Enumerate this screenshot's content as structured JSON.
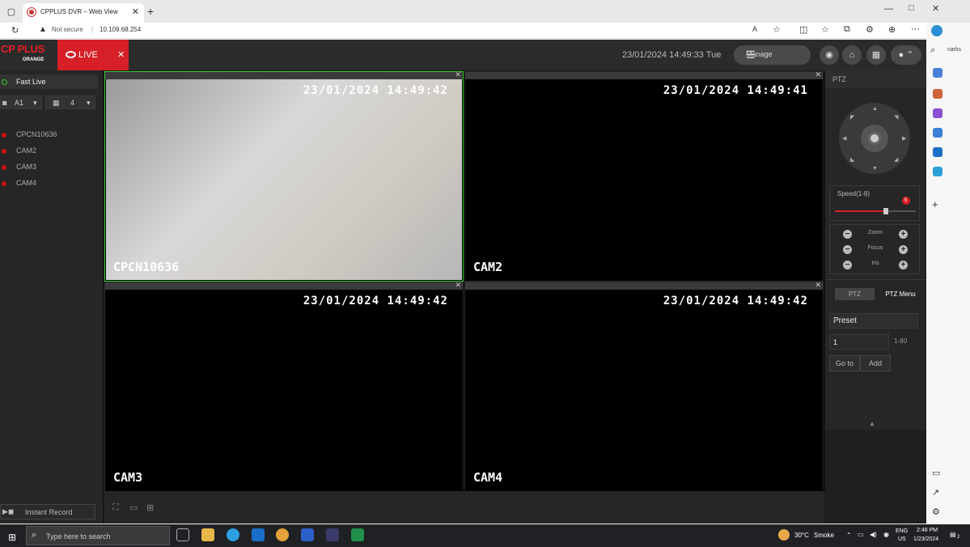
{
  "browser": {
    "tab_title": "CPPLUS DVR – Web View",
    "not_secure": "Not secure",
    "url": "10.109.68.254",
    "sidebar_partial": "narks"
  },
  "app": {
    "logo_main": "CP PLUS",
    "logo_sub": "ORANGE",
    "live_label": "LIVE",
    "datetime": "23/01/2024 14:49:33 Tue",
    "manage_label": "Manage"
  },
  "left_panel": {
    "fast_live": "Fast Live",
    "stream_select": "A1",
    "layout_select": "4",
    "cameras": [
      "CPCN10636",
      "CAM2",
      "CAM3",
      "CAM4"
    ],
    "instant_record": "Instant Record"
  },
  "tiles": [
    {
      "name": "CPCN10636",
      "timestamp": "23/01/2024 14:49:42"
    },
    {
      "name": "CAM2",
      "timestamp": "23/01/2024 14:49:41"
    },
    {
      "name": "CAM3",
      "timestamp": "23/01/2024 14:49:42"
    },
    {
      "name": "CAM4",
      "timestamp": "23/01/2024 14:49:42"
    }
  ],
  "ptz": {
    "title": "PTZ",
    "speed_label": "Speed(1-8)",
    "speed_value": "5",
    "speed_fraction": 0.625,
    "controls": [
      "Zoom",
      "Focus",
      "Iris"
    ],
    "tabs": [
      "PTZ",
      "PTZ Menu"
    ],
    "preset_select": "Preset",
    "preset_number": "1",
    "preset_range": "1-80",
    "goto_button": "Go to",
    "add_button": "Add"
  },
  "taskbar": {
    "search_placeholder": "Type here to search",
    "weather_temp": "30°C",
    "weather_desc": "Smoke",
    "lang1": "ENG",
    "lang2": "US",
    "time": "2:48 PM",
    "date": "1/23/2024",
    "notification_count": "2"
  },
  "colors": {
    "accent": "#d61f26",
    "active_tile": "#33cc33"
  }
}
